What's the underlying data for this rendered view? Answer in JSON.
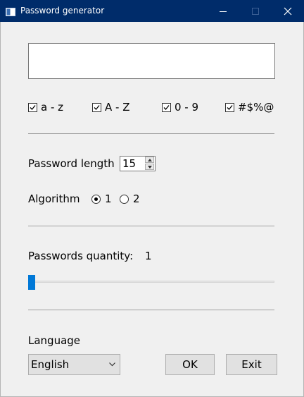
{
  "window": {
    "title": "Password generator",
    "icons": {
      "app": "window-app-icon",
      "minimize": "minimize-icon",
      "maximize": "maximize-icon",
      "close": "close-icon"
    },
    "colors": {
      "titlebar": "#002c6a",
      "accent": "#0078d7"
    }
  },
  "password_output": {
    "value": ""
  },
  "charsets": [
    {
      "label": "a - z",
      "checked": true
    },
    {
      "label": "A - Z",
      "checked": true
    },
    {
      "label": "0 - 9",
      "checked": true
    },
    {
      "label": "#$%@",
      "checked": true
    }
  ],
  "length": {
    "label": "Password length",
    "value": "15"
  },
  "algorithm": {
    "label": "Algorithm",
    "options": [
      {
        "label": "1",
        "selected": true
      },
      {
        "label": "2",
        "selected": false
      }
    ]
  },
  "quantity": {
    "label": "Passwords quantity:",
    "value": "1",
    "slider_fraction": 0.0
  },
  "language": {
    "label": "Language",
    "selected": "English"
  },
  "buttons": {
    "ok": "OK",
    "exit": "Exit"
  }
}
